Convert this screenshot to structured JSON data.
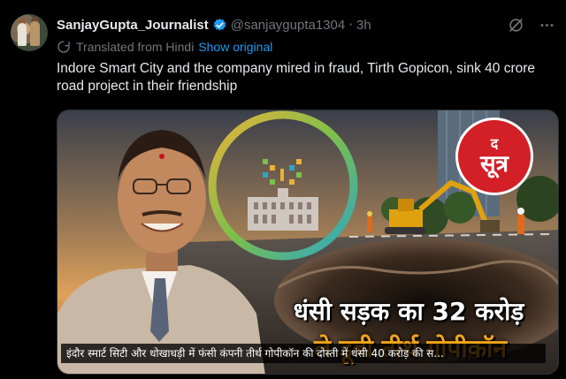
{
  "tweet": {
    "display_name": "SanjayGupta_Journalist",
    "handle": "@sanjaygupta1304",
    "time": "3h",
    "translated_label": "Translated from Hindi",
    "show_original_label": "Show original",
    "text": "Indore Smart City and the company mired in fraud, Tirth Gopicon, sink 40 crore road project in their friendship"
  },
  "media": {
    "headline_line1": "धंसी सड़क का 32 करोड़",
    "headline_line2": "ले डूबी तीर्थ गोपीकॉन",
    "logo_small": "द",
    "logo_big": "सूत्र",
    "caption": "इंदौर स्मार्ट सिटी और धोखाधड़ी में फंसी कंपनी तीर्थ गोपीकॉन की दोस्ती में धंसी 40 करोड़ की स..."
  },
  "colors": {
    "background": "#000000",
    "text_primary": "#e7e9ea",
    "text_secondary": "#71767b",
    "link": "#1d9bf0",
    "verified_badge": "#1d9bf0",
    "logo_red": "#d31f26",
    "headline_accent": "#f0a418"
  },
  "icons": {
    "verified": "verified-badge-icon",
    "grok": "grok-icon",
    "more": "more-icon",
    "translate": "translate-icon"
  }
}
